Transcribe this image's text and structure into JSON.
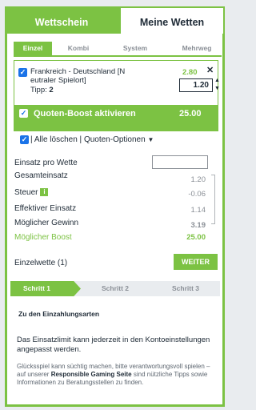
{
  "tabs": {
    "active": "Wettschein",
    "inactive": "Meine Wetten"
  },
  "subtabs": [
    "Einzel",
    "Kombi",
    "System",
    "Mehrweg"
  ],
  "bet": {
    "match_line1": "Frankreich - Deutschland [N",
    "match_line2": "eutraler Spielort]",
    "tipp_label": "Tipp:",
    "tipp_value": "2",
    "odds": "2.80",
    "close": "✕",
    "stake": "1.20",
    "boost_label": "Quoten-Boost aktivieren",
    "boost_value": "25.00"
  },
  "actions": {
    "separator": "|",
    "clear_all": "Alle löschen",
    "odds_options": "Quoten-Optionen"
  },
  "summary": {
    "einsatz_pro_wette": "Einsatz pro Wette",
    "gesamteinsatz": "Gesamteinsatz",
    "gesamteinsatz_val": "1.20",
    "steuer": "Steuer",
    "steuer_info": "i",
    "steuer_val": "-0.06",
    "effektiver_einsatz": "Effektiver Einsatz",
    "effektiver_einsatz_val": "1.14",
    "moeglicher_gewinn": "Möglicher Gewinn",
    "moeglicher_gewinn_val": "3.19",
    "moeglicher_boost": "Möglicher Boost",
    "moeglicher_boost_val": "25.00"
  },
  "single_bet": "Einzelwette (1)",
  "weiter": "WEITER",
  "steps": [
    "Schritt 1",
    "Schritt 2",
    "Schritt 3"
  ],
  "deposit_link": "Zu den Einzahlungsarten",
  "limit_text": "Das Einsatzlimit kann jederzeit in den Kontoeinstellungen angepasst werden.",
  "disclaimer": {
    "part1": "Glücksspiel kann süchtig machen, bitte verantwortungsvoll spielen – auf unserer",
    "link": "Responsible Gaming Seite",
    "part2": "sind nützliche Tipps sowie Informationen zu Beratungsstellen zu finden."
  },
  "colors": {
    "accent": "#7cc243",
    "checkbox": "#1a73e8",
    "text": "#1e2a36"
  }
}
